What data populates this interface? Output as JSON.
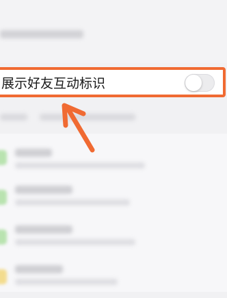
{
  "setting": {
    "label": "展示好友互动标识",
    "enabled": false
  },
  "colors": {
    "highlight": "#f06a32",
    "icon_green": "#b9e3b0",
    "icon_yellow": "#f3dc8e"
  },
  "icons": {
    "annotation": "arrow-icon",
    "toggle": "toggle-switch"
  }
}
